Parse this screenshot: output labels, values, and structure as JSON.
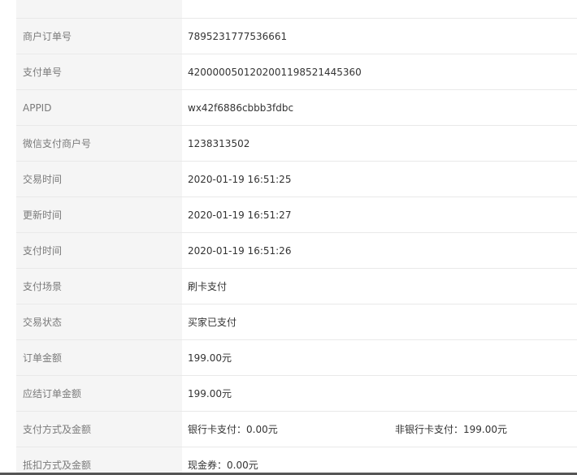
{
  "rows": [
    {
      "label": "商户订单号",
      "value": "7895231777536661"
    },
    {
      "label": "支付单号",
      "value": "4200000501202001198521445360"
    },
    {
      "label": "APPID",
      "value": "wx42f6886cbbb3fdbc"
    },
    {
      "label": "微信支付商户号",
      "value": "1238313502"
    },
    {
      "label": "交易时间",
      "value": "2020-01-19 16:51:25"
    },
    {
      "label": "更新时间",
      "value": "2020-01-19 16:51:27"
    },
    {
      "label": "支付时间",
      "value": "2020-01-19 16:51:26"
    },
    {
      "label": "支付场景",
      "value": "刷卡支付"
    },
    {
      "label": "交易状态",
      "value": "买家已支付"
    },
    {
      "label": "订单金额",
      "value": "199.00元"
    },
    {
      "label": "应结订单金额",
      "value": "199.00元"
    },
    {
      "label": "支付方式及金额",
      "value": "银行卡支付：0.00元",
      "value2": "非银行卡支付：199.00元"
    },
    {
      "label": "抵扣方式及金额",
      "value": "现金券：0.00元"
    }
  ]
}
